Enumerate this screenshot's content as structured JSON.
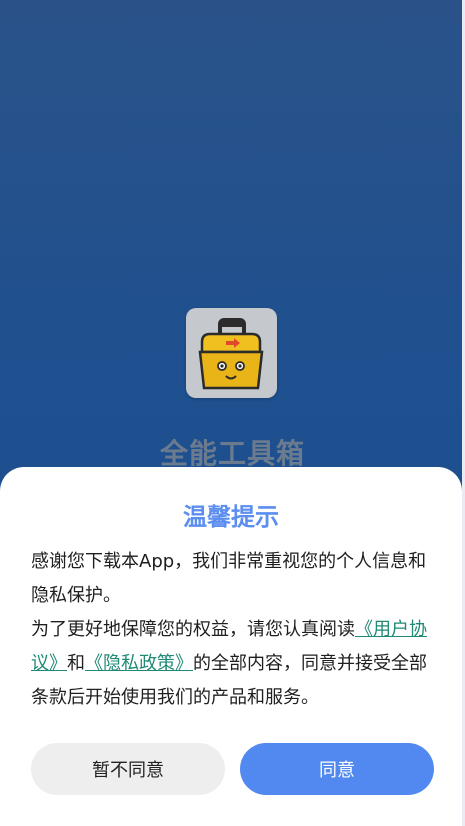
{
  "app": {
    "name": "全能工具箱",
    "icon_name": "toolbox-icon"
  },
  "dialog": {
    "title": "温馨提示",
    "paragraph1": "感谢您下载本App，我们非常重视您的个人信息和隐私保护。",
    "paragraph2_prefix": "为了更好地保障您的权益，请您认真阅读",
    "user_agreement_link": "《用户协议》",
    "conjunction": "和",
    "privacy_policy_link": "《隐私政策》",
    "paragraph2_suffix": "的全部内容，同意并接受全部条款后开始使用我们的产品和服务。",
    "decline_label": "暂不同意",
    "agree_label": "同意"
  },
  "colors": {
    "background": "#1f508f",
    "accent": "#5289f0",
    "link": "#1f8a76",
    "title": "#5c8ef0"
  }
}
